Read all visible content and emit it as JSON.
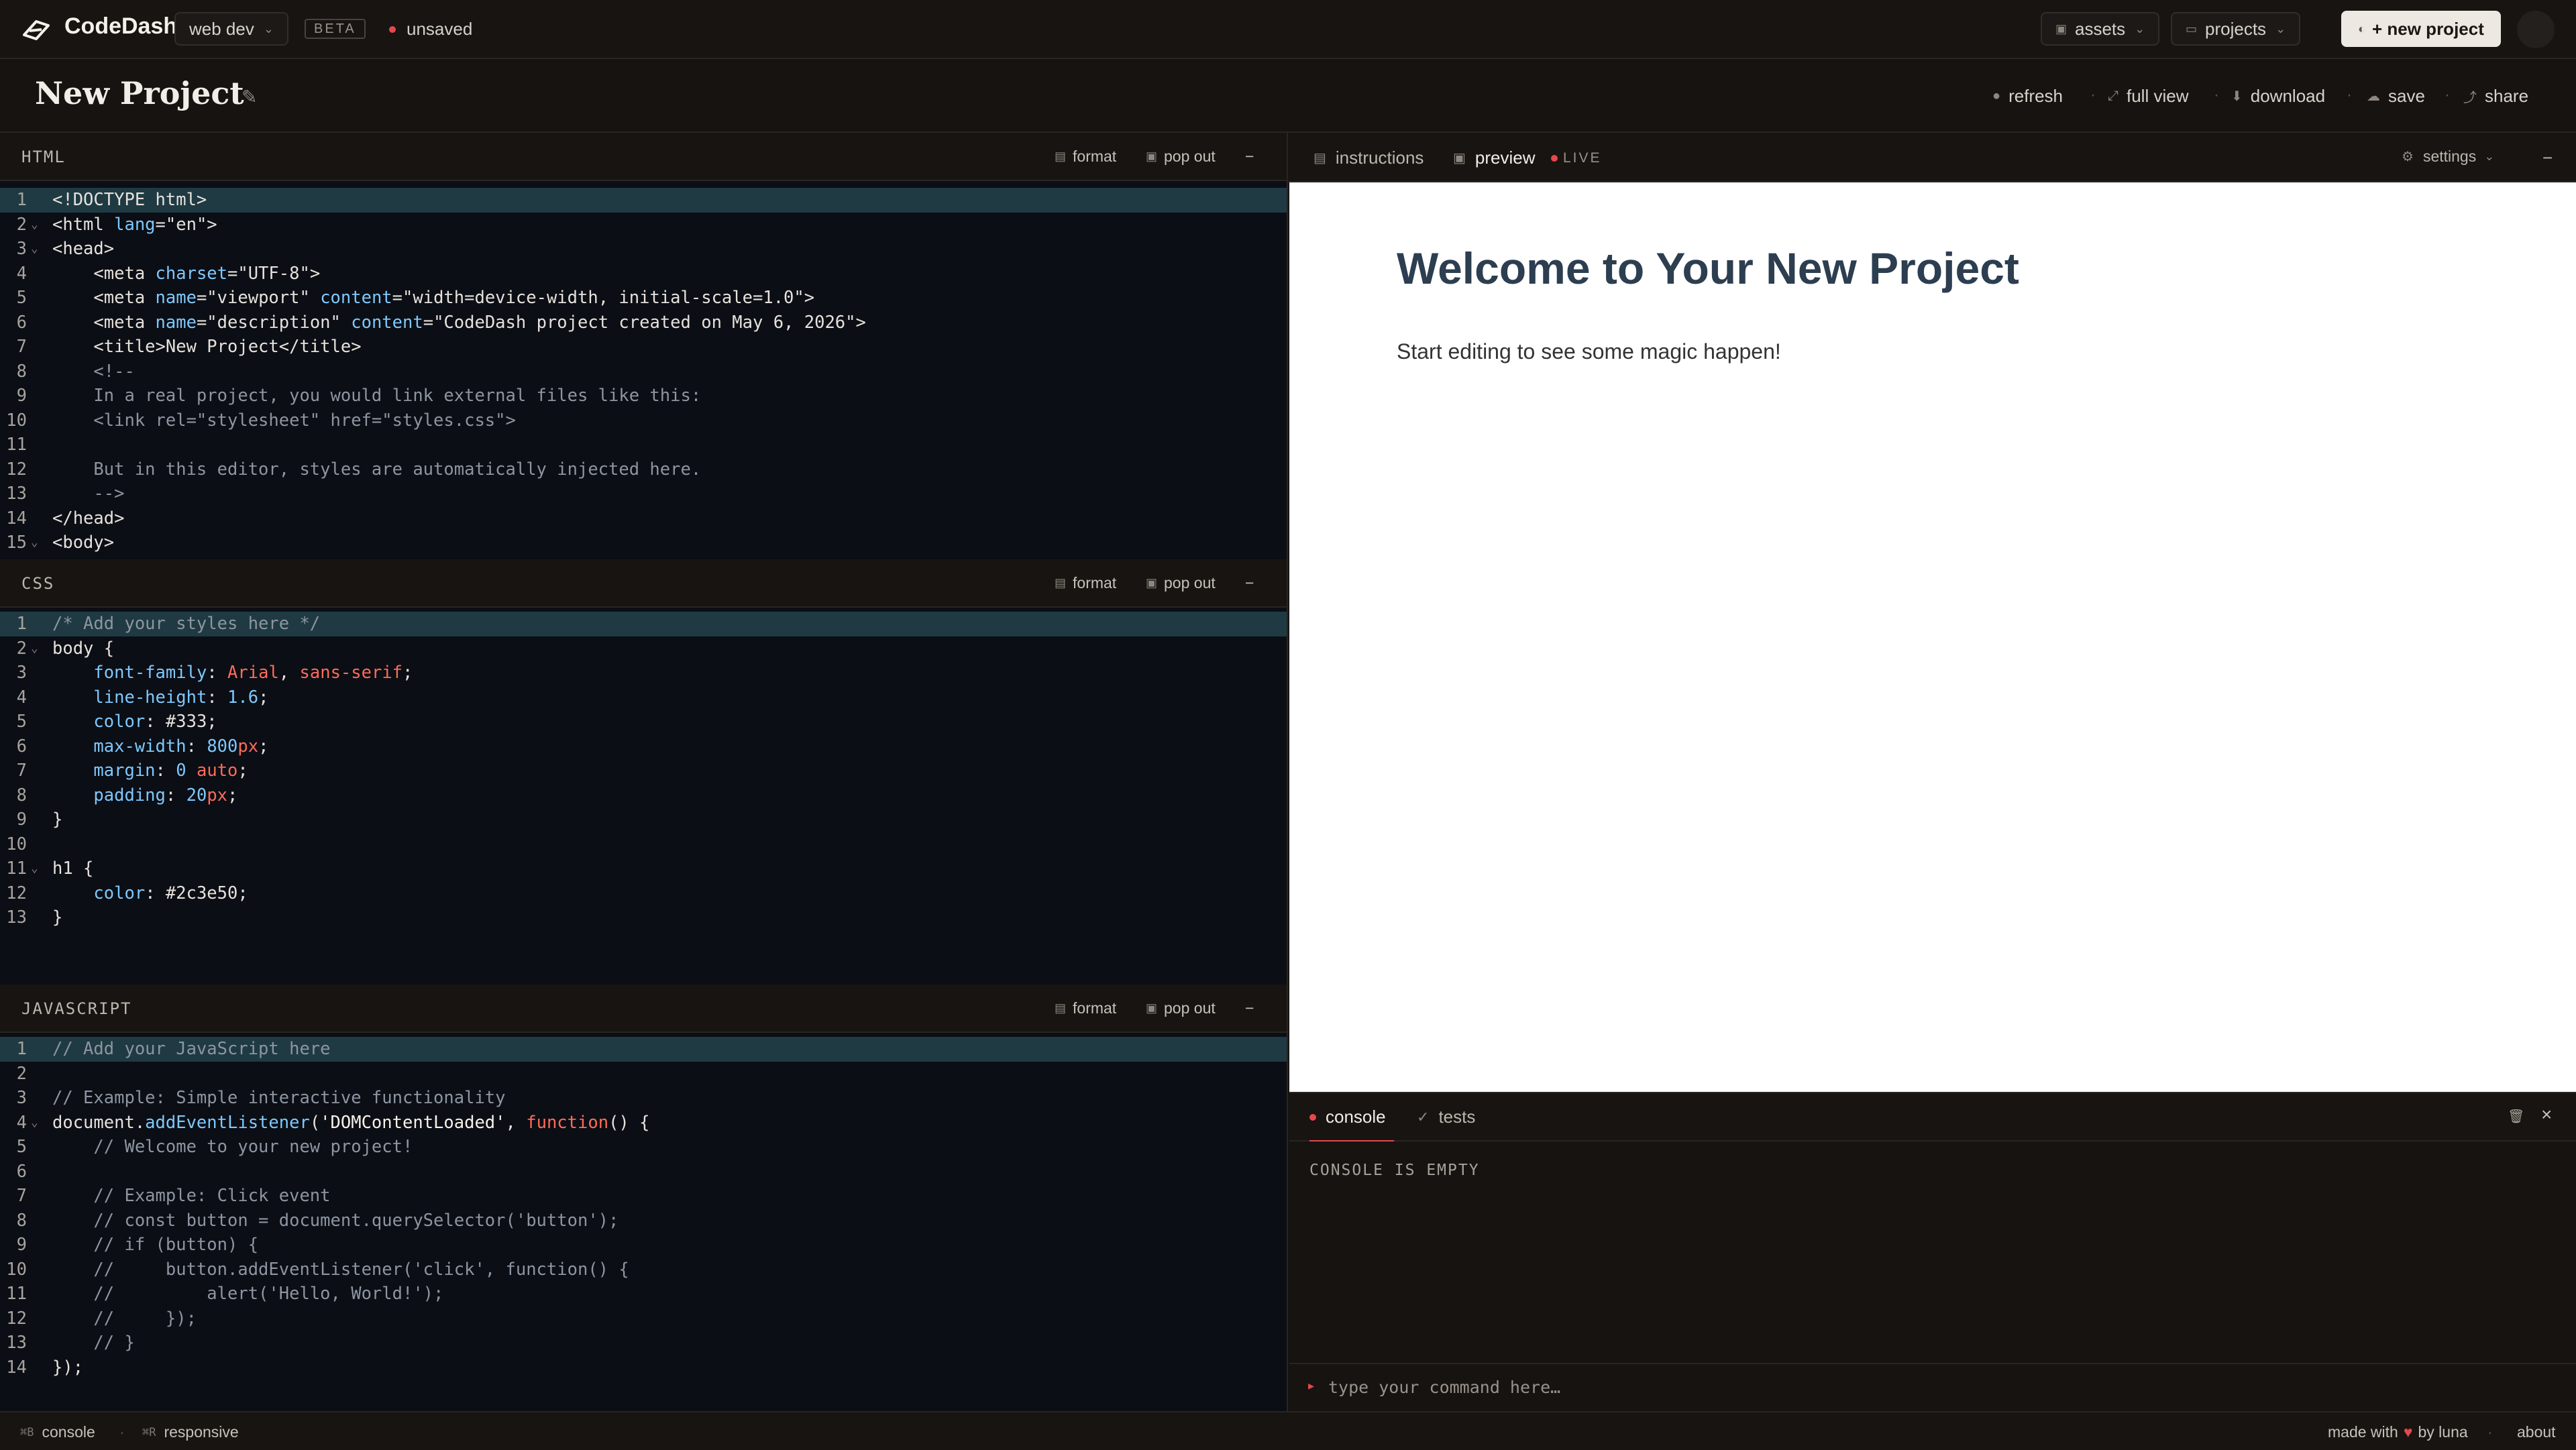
{
  "topbar": {
    "brand": "CodeDash",
    "workspace": "web dev",
    "badge": "BETA",
    "status": "unsaved",
    "assets": "assets",
    "projects": "projects",
    "new_project": "+ new project"
  },
  "titlebar": {
    "title": "New Project",
    "actions": [
      "refresh",
      "full view",
      "download",
      "save",
      "share"
    ]
  },
  "panes": {
    "html": {
      "title": "HTML",
      "format": "format",
      "popout": "pop out",
      "minimize": "−"
    },
    "css": {
      "title": "CSS",
      "format": "format",
      "popout": "pop out",
      "minimize": "−"
    },
    "js": {
      "title": "JAVASCRIPT",
      "format": "format",
      "popout": "pop out",
      "minimize": "−"
    }
  },
  "html_code": [
    "<!DOCTYPE html>",
    "<html lang=\"en\">",
    "<head>",
    "    <meta charset=\"UTF-8\">",
    "    <meta name=\"viewport\" content=\"width=device-width, initial-scale=1.0\">",
    "    <meta name=\"description\" content=\"CodeDash project created on May 6, 2026\">",
    "    <title>New Project</title>",
    "    <!--",
    "    In a real project, you would link external files like this:",
    "    <link rel=\"stylesheet\" href=\"styles.css\">",
    "",
    "    But in this editor, styles are automatically injected here.",
    "    -->",
    "</head>",
    "<body>"
  ],
  "css_code": [
    "/* Add your styles here */",
    "body {",
    "    font-family: Arial, sans-serif;",
    "    line-height: 1.6;",
    "    color: #333;",
    "    max-width: 800px;",
    "    margin: 0 auto;",
    "    padding: 20px;",
    "}",
    "",
    "h1 {",
    "    color: #2c3e50;",
    "}"
  ],
  "js_code": [
    "// Add your JavaScript here",
    "",
    "// Example: Simple interactive functionality",
    "document.addEventListener('DOMContentLoaded', function() {",
    "    // Welcome to your new project!",
    "",
    "    // Example: Click event",
    "    // const button = document.querySelector('button');",
    "    // if (button) {",
    "    //     button.addEventListener('click', function() {",
    "    //         alert('Hello, World!');",
    "    //     });",
    "    // }",
    "});"
  ],
  "right": {
    "tab_instructions": "instructions",
    "tab_preview": "preview",
    "live": "LIVE",
    "settings": "settings",
    "minimize": "−"
  },
  "preview": {
    "heading": "Welcome to Your New Project",
    "paragraph": "Start editing to see some magic happen!"
  },
  "console": {
    "tab_console": "console",
    "tab_tests": "tests",
    "empty": "CONSOLE IS EMPTY",
    "placeholder": "type your command here…"
  },
  "status": {
    "console_key": "⌘B",
    "console": "console",
    "responsive_key": "⌘R",
    "responsive": "responsive",
    "made_with": "made with",
    "by": "by luna",
    "about": "about"
  },
  "colors": {
    "accent_red": "#e5484d",
    "preview_heading": "#2c3e50",
    "editor_bg": "#0b0e14",
    "line_highlight": "#1f3a43"
  }
}
